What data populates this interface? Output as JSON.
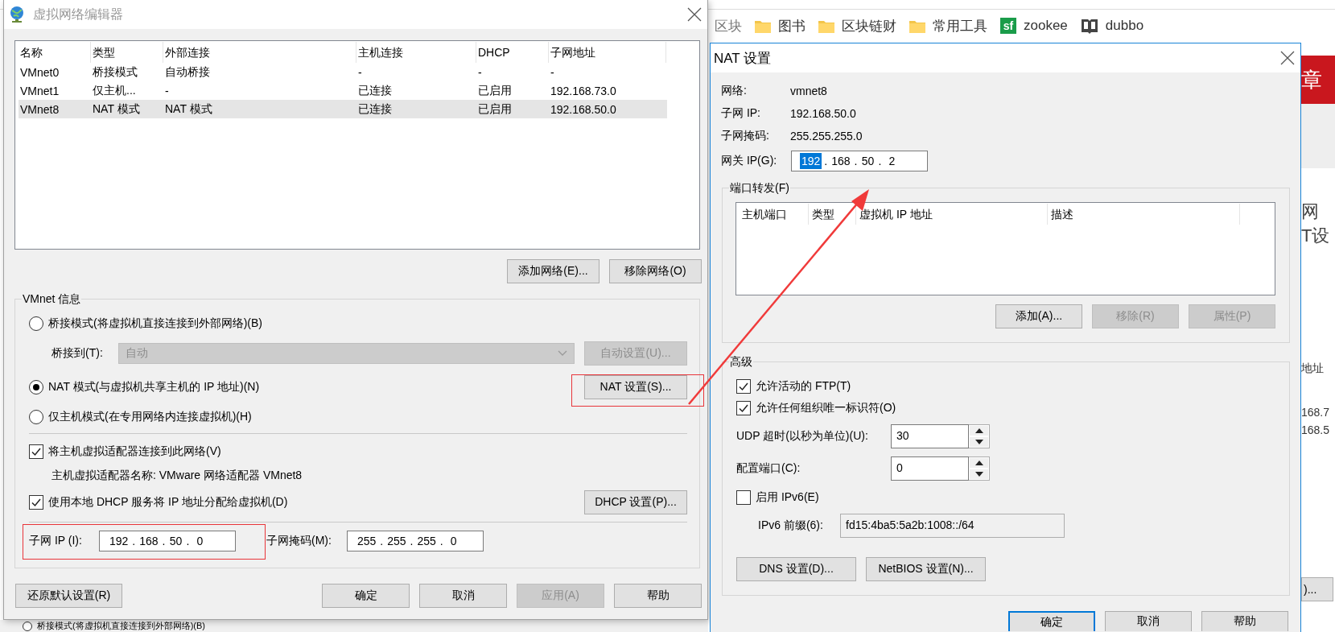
{
  "browser": {
    "bookmarks": [
      {
        "label": "区块",
        "kind": "text"
      },
      {
        "label": "图书",
        "kind": "folder"
      },
      {
        "label": "区块链财",
        "kind": "folder"
      },
      {
        "label": "常用工具",
        "kind": "folder"
      },
      {
        "label": "zookee",
        "kind": "site",
        "icon_text": "sf"
      },
      {
        "label": "dubbo",
        "kind": "book"
      }
    ],
    "page_fragments": [
      {
        "text": "章",
        "kind": "banner"
      },
      {
        "text": "网",
        "kind": "heading"
      },
      {
        "text": "T设",
        "kind": "heading"
      },
      {
        "text": "地址",
        "kind": "text"
      },
      {
        "text": "168.7",
        "kind": "text"
      },
      {
        "text": "168.5",
        "kind": "text"
      },
      {
        "text": ")...",
        "kind": "button"
      }
    ]
  },
  "background_window": {
    "mode": {
      "label": "桥接模式(将虚拟机直接连接到外部网络)(B)",
      "selected": false
    }
  },
  "vnet_editor": {
    "title": "虚拟网络编辑器",
    "columns": [
      "名称",
      "类型",
      "外部连接",
      "主机连接",
      "DHCP",
      "子网地址"
    ],
    "rows": [
      {
        "cells": [
          "VMnet0",
          "桥接模式",
          "自动桥接",
          "-",
          "-",
          "-"
        ],
        "selected": false
      },
      {
        "cells": [
          "VMnet1",
          "仅主机...",
          "-",
          "已连接",
          "已启用",
          "192.168.73.0"
        ],
        "selected": false
      },
      {
        "cells": [
          "VMnet8",
          "NAT 模式",
          "NAT 模式",
          "已连接",
          "已启用",
          "192.168.50.0"
        ],
        "selected": true
      }
    ],
    "list_buttons": [
      {
        "label": "添加网络(E)..."
      },
      {
        "label": "移除网络(O)"
      }
    ],
    "info": {
      "title": "VMnet 信息",
      "modes": [
        {
          "label": "桥接模式(将虚拟机直接连接到外部网络)(B)",
          "selected": false
        },
        {
          "label": "NAT 模式(与虚拟机共享主机的 IP 地址)(N)",
          "selected": true
        },
        {
          "label": "仅主机模式(在专用网络内连接虚拟机)(H)",
          "selected": false
        }
      ],
      "bridge_to": {
        "label": "桥接到(T):",
        "value": "自动",
        "disabled": true
      },
      "auto_button": {
        "label": "自动设置(U)...",
        "disabled": true,
        "highlighted": false
      },
      "nat_button": {
        "label": "NAT 设置(S)...",
        "disabled": false,
        "highlighted": true
      },
      "connect_adapter": {
        "label": "将主机虚拟适配器连接到此网络(V)",
        "checked": true
      },
      "adapter_name": "主机虚拟适配器名称: VMware 网络适配器 VMnet8",
      "use_dhcp": {
        "label": "使用本地 DHCP 服务将 IP 地址分配给虚拟机(D)",
        "checked": true
      },
      "dhcp_button": {
        "label": "DHCP 设置(P)...",
        "disabled": false,
        "highlighted": false
      },
      "subnet_ip": {
        "label": "子网 IP (I):",
        "separator": ".",
        "highlighted": true,
        "octets": [
          {
            "text": "192",
            "selected": false
          },
          {
            "text": "168",
            "selected": false
          },
          {
            "text": "50",
            "selected": false
          },
          {
            "text": "0",
            "selected": false
          }
        ]
      },
      "subnet_mask": {
        "label": "子网掩码(M):",
        "separator": ".",
        "highlighted": false,
        "octets": [
          {
            "text": "255",
            "selected": false
          },
          {
            "text": "255",
            "selected": false
          },
          {
            "text": "255",
            "selected": false
          },
          {
            "text": "0",
            "selected": false
          }
        ]
      }
    },
    "footer_buttons": [
      {
        "label": "还原默认设置(R)",
        "disabled": false
      },
      {
        "label": "确定",
        "disabled": false
      },
      {
        "label": "取消",
        "disabled": false
      },
      {
        "label": "应用(A)",
        "disabled": true
      },
      {
        "label": "帮助",
        "disabled": false
      }
    ]
  },
  "nat_settings": {
    "title": "NAT 设置",
    "info": [
      {
        "label": "网络:",
        "value": "vmnet8"
      },
      {
        "label": "子网 IP:",
        "value": "192.168.50.0"
      },
      {
        "label": "子网掩码:",
        "value": "255.255.255.0"
      }
    ],
    "gateway": {
      "label": "网关 IP(G):",
      "separator": ".",
      "octets": [
        {
          "text": "192",
          "selected": true
        },
        {
          "text": "168",
          "selected": false
        },
        {
          "text": "50",
          "selected": false
        },
        {
          "text": "2",
          "selected": false
        }
      ]
    },
    "port_forwarding": {
      "title": "端口转发(F)",
      "columns": [
        "主机端口",
        "类型",
        "虚拟机 IP 地址",
        "描述"
      ],
      "buttons": [
        {
          "label": "添加(A)...",
          "disabled": false
        },
        {
          "label": "移除(R)",
          "disabled": true
        },
        {
          "label": "属性(P)",
          "disabled": true
        }
      ]
    },
    "advanced": {
      "title": "高级",
      "options": [
        {
          "label": "允许活动的 FTP(T)",
          "checked": true
        },
        {
          "label": "允许任何组织唯一标识符(O)",
          "checked": true
        }
      ],
      "udp_timeout": {
        "label": "UDP 超时(以秒为单位)(U):",
        "value": "30"
      },
      "config_port": {
        "label": "配置端口(C):",
        "value": "0"
      },
      "ipv6": {
        "label": "启用 IPv6(E)",
        "checked": false
      },
      "ipv6_prefix": {
        "label": "IPv6 前缀(6):",
        "value": "fd15:4ba5:5a2b:1008::/64"
      },
      "buttons": [
        {
          "label": "DNS 设置(D)..."
        },
        {
          "label": "NetBIOS 设置(N)..."
        }
      ]
    },
    "footer_buttons": [
      {
        "label": "确定",
        "default": true
      },
      {
        "label": "取消",
        "default": false
      },
      {
        "label": "帮助",
        "default": false
      }
    ]
  }
}
